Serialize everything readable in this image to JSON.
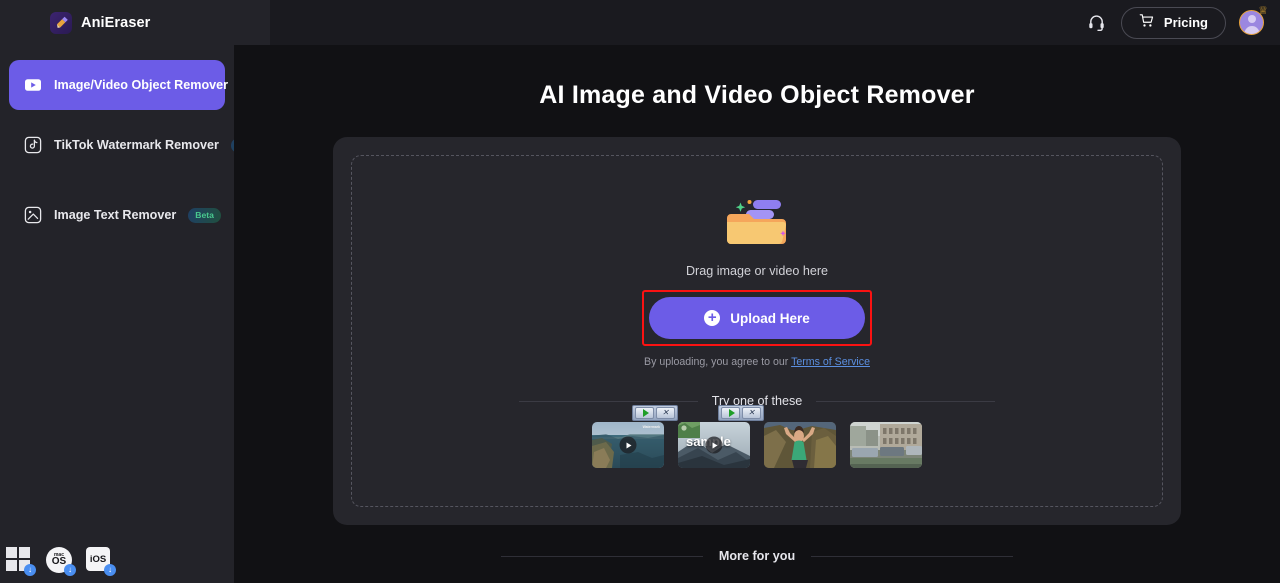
{
  "app": {
    "name": "AniEraser",
    "logo_icon": "eraser-icon"
  },
  "header": {
    "support_icon": "headset-icon",
    "pricing_label": "Pricing",
    "cart_icon": "shopping-cart-icon",
    "avatar_icon": "user-avatar",
    "crown_icon": "crown-icon",
    "accent_color": "#6c5ce7"
  },
  "sidebar": {
    "items": [
      {
        "label": "Image/Video Object Remover",
        "icon": "video-play-icon",
        "active": true,
        "badge": ""
      },
      {
        "label": "TikTok Watermark Remover",
        "icon": "tiktok-note-icon",
        "active": false,
        "badge": "Beta"
      },
      {
        "label": "Image Text Remover",
        "icon": "image-text-icon",
        "active": false,
        "badge": "Beta"
      }
    ],
    "platforms": [
      {
        "name": "windows-download",
        "label": "",
        "badge_icon": "download-arrow-icon"
      },
      {
        "name": "macos-download",
        "label_top": "mac",
        "label": "OS",
        "badge_icon": "download-arrow-icon"
      },
      {
        "name": "ios-download",
        "label": "iOS",
        "badge_icon": "download-arrow-icon"
      }
    ]
  },
  "main": {
    "title": "AI Image and Video Object Remover",
    "dropzone": {
      "folder_icon": "open-folder-upload-icon",
      "drag_text": "Drag image or video here",
      "upload_label": "Upload Here",
      "upload_icon": "plus-circle-icon",
      "highlight_color": "#fa1212",
      "terms_prefix": "By uploading, you agree to our ",
      "terms_link": "Terms of Service"
    },
    "try_label": "Try one of these",
    "samples": [
      {
        "name": "sample-cliff-coast-video",
        "overlay_label": "",
        "has_play": true,
        "has_video_control": true,
        "watermark": "Watermark"
      },
      {
        "name": "sample-mountain-video",
        "overlay_label": "sample",
        "has_play": true,
        "has_video_control": true,
        "watermark": ""
      },
      {
        "name": "sample-woman-rocks-image",
        "overlay_label": "",
        "has_play": false,
        "has_video_control": false,
        "watermark": ""
      },
      {
        "name": "sample-city-street-image",
        "overlay_label": "",
        "has_play": false,
        "has_video_control": false,
        "watermark": ""
      }
    ],
    "more_label": "More for you"
  }
}
